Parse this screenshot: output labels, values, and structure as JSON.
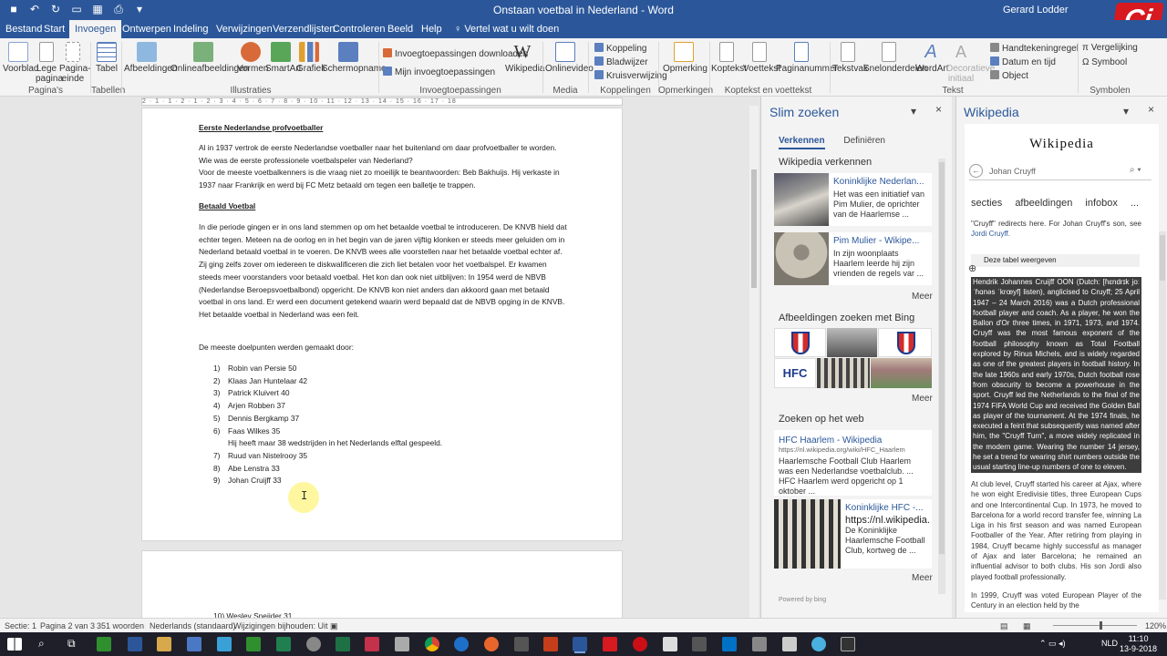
{
  "window": {
    "title": "Onstaan voetbal in Nederland - Word",
    "user": "Gerard Lodder",
    "logo_text": "Ci"
  },
  "tabs": [
    "Bestand",
    "Start",
    "Invoegen",
    "Ontwerpen",
    "Indeling",
    "Verwijzingen",
    "Verzendlijsten",
    "Controleren",
    "Beeld",
    "Help"
  ],
  "tell_me": "Vertel wat u wilt doen",
  "ribbon": {
    "buttons": {
      "voorblad": "Voorblad",
      "lege_pagina": "Lege pagina",
      "pagina_einde": "Pagina-einde",
      "tabel": "Tabel",
      "afbeeldingen": "Afbeeldingen",
      "onlineafbeeldingen": "Onlineafbeeldingen",
      "vormen": "Vormen",
      "smartart": "SmartArt",
      "grafiek": "Grafiek",
      "schermopname": "Schermopname",
      "invoegtoep_downloaden": "Invoegtoepassingen downloaden",
      "mijn_invoegtoep": "Mijn invoegtoepassingen",
      "wikipedia": "Wikipedia",
      "onlinevideo": "Onlinevideo",
      "koppeling": "Koppeling",
      "bladwijzer": "Bladwijzer",
      "kruisverwijzing": "Kruisverwijzing",
      "opmerking": "Opmerking",
      "koptekst": "Koptekst",
      "voettekst": "Voettekst",
      "paginanummer": "Paginanummer",
      "tekstvak": "Tekstvak",
      "snelonderdelen": "Snelonderdelen",
      "wordart": "WordArt",
      "decoratieve_initiaal": "Decoratieve initiaal",
      "handtekeningregel": "Handtekeningregel",
      "datum_en_tijd": "Datum en tijd",
      "object": "Object",
      "vergelijking": "Vergelijking",
      "symbool": "Symbool"
    },
    "groups": {
      "paginas": "Pagina's",
      "tabellen": "Tabellen",
      "illustraties": "Illustraties",
      "invoegtoepassingen": "Invoegtoepassingen",
      "media": "Media",
      "koppelingen": "Koppelingen",
      "opmerkingen": "Opmerkingen",
      "koptekst_voettekst": "Koptekst en voettekst",
      "tekst": "Tekst",
      "symbolen": "Symbolen"
    }
  },
  "ruler_text": "2 · 1 · 1 · 2 · 1 · 2 · 3 · 4 · 5 · 6 · 7 · 8 · 9 · 10 · 11 · 12 · 13 · 14 · 15 · 16 · 17 · 18",
  "document": {
    "heading1": "Eerste Nederlandse profvoetballer",
    "para1": "Al in 1937 vertrok de eerste Nederlandse voetballer naar het buitenland om daar profvoetballer te worden. Wie was de eerste professionele voetbalspeler van Nederland?",
    "para2": "Voor de meeste voetbalkenners is die vraag niet zo moeilijk te beantwoorden: Beb Bakhuijs. Hij verkaste in 1937 naar Frankrijk en werd bij FC Metz betaald om tegen een balletje te trappen.",
    "heading2": "Betaald Voetbal",
    "para3": "In die periode gingen er in ons land stemmen op om het betaalde voetbal te introduceren. De KNVB hield dat echter tegen. Meteen na de oorlog en in het begin van de jaren vijftig klonken er steeds meer geluiden om in Nederland betaald voetbal in te voeren. De KNVB wees alle voorstellen naar het betaalde voetbal echter af. Zij ging zelfs zover om iedereen te diskwalificeren die zich liet betalen voor het voetbalspel. Er kwamen steeds meer voorstanders voor betaald voetbal. Het kon dan ook niet uitblijven: In 1954 werd de NBVB (Nederlandse Beroepsvoetbalbond) opgericht. De KNVB kon niet anders dan akkoord gaan met betaald voetbal in ons land. Er werd een document getekend waarin werd bepaald dat de NBVB opging in de KNVB. Het betaalde voetbal in Nederland was een feit.",
    "para4": "De meeste doelpunten werden gemaakt door:",
    "list": [
      {
        "n": "1)",
        "t": "Robin van Persie 50"
      },
      {
        "n": "2)",
        "t": "Klaas Jan Huntelaar 42"
      },
      {
        "n": "3)",
        "t": "Patrick Kluivert 40"
      },
      {
        "n": "4)",
        "t": "Arjen Robben 37"
      },
      {
        "n": "5)",
        "t": "Dennis Bergkamp 37"
      },
      {
        "n": "6)",
        "t": "Faas Wilkes 35"
      },
      {
        "n": "",
        "t": "Hij heeft maar 38 wedstrijden in het Nederlands elftal gespeeld."
      },
      {
        "n": "7)",
        "t": "Ruud van Nistelrooy 35"
      },
      {
        "n": "8)",
        "t": "Abe Lenstra 33"
      },
      {
        "n": "9)",
        "t": "Johan Cruijff 33"
      }
    ],
    "page2_item": "10) Wesley Sneijder 31"
  },
  "smart_lookup": {
    "title": "Slim zoeken",
    "tab_active": "Verkennen",
    "tab_other": "Definiëren",
    "section_wiki": "Wikipedia verkennen",
    "wiki_cards": [
      {
        "title": "Koninklijke Nederlan...",
        "desc": "Het was een initiatief van Pim Mulier, de oprichter van de Haarlemse ..."
      },
      {
        "title": "Pim Mulier - Wikipe...",
        "desc": "In zijn woonplaats Haarlem leerde hij zijn vrienden de regels var ..."
      }
    ],
    "more": "Meer",
    "section_images": "Afbeeldingen zoeken met Bing",
    "section_web": "Zoeken op het web",
    "web_results": [
      {
        "title": "HFC Haarlem - Wikipedia",
        "url": "https://nl.wikipedia.org/wiki/HFC_Haarlem",
        "desc": "Haarlemsche Football Club Haarlem was een Nederlandse voetbalclub. ... HFC Haarlem werd opgericht op 1 oktober ..."
      },
      {
        "title": "Koninklijke HFC -...",
        "url": "https://nl.wikipedia.org/wi...",
        "desc": "De Koninklijke Haarlemsche Football Club, kortweg de ..."
      }
    ],
    "image_label": "HFC",
    "powered": "Powered by bing"
  },
  "wikipedia": {
    "title": "Wikipedia",
    "logo": "Wikipedia",
    "search_value": "Johan Cruyff",
    "tabs": [
      "secties",
      "afbeeldingen",
      "infobox",
      "..."
    ],
    "redirect": "\"Cruyff\" redirects here. For Johan Cruyff's son, see",
    "redirect_link": "Jordi Cruyff.",
    "table_label": "Deze tabel weergeven",
    "selected_text": "Hendrik Johannes Cruijff OON (Dutch: [ɦɛndrɪk joːˈɦɑnəs ˈkrœyf] listen), anglicised to Cruyff; 25 April 1947 – 24 March 2016) was a Dutch professional football player and coach. As a player, he won the Ballon d'Or three times, in 1971, 1973, and 1974. Cruyff was the most famous exponent of the football philosophy known as Total Football explored by Rinus Michels, and is widely regarded as one of the greatest players in football history. In the late 1960s and early 1970s, Dutch football rose from obscurity to become a powerhouse in the sport. Cruyff led the Netherlands to the final of the 1974 FIFA World Cup and received the Golden Ball as player of the tournament. At the 1974 finals, he executed a feint that subsequently was named after him, the \"Cruyff Turn\", a move widely replicated in the modern game. Wearing the number 14 jersey, he set a trend for wearing shirt numbers outside the usual starting line-up numbers of one to eleven.",
    "para2": "At club level, Cruyff started his career at Ajax, where he won eight Eredivisie titles, three European Cups and one Intercontinental Cup. In 1973, he moved to Barcelona for a world record transfer fee, winning La Liga in his first season and was named European Footballer of the Year. After retiring from playing in 1984, Cruyff became highly successful as manager of Ajax and later Barcelona; he remained an influential advisor to both clubs. His son Jordi also played football professionally.",
    "para3": "In 1999, Cruyff was voted European Player of the Century in an election held by the"
  },
  "status": {
    "section": "Sectie: 1",
    "page": "Pagina 2 van 3",
    "words": "351 woorden",
    "language": "Nederlands (standaard)",
    "track": "Wijzigingen bijhouden: Uit",
    "zoom": "120%"
  },
  "taskbar": {
    "language": "NLD",
    "time": "11:10",
    "date": "13-9-2018"
  }
}
